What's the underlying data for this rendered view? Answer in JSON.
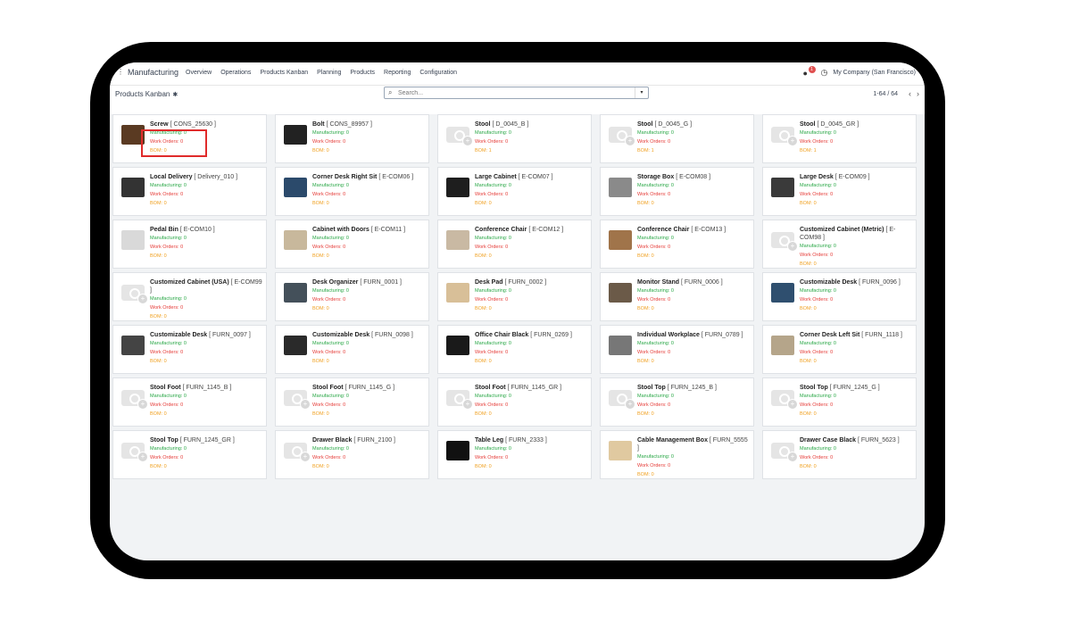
{
  "nav": {
    "app": "Manufacturing",
    "menu": [
      "Overview",
      "Operations",
      "Products Kanban",
      "Planning",
      "Products",
      "Reporting",
      "Configuration"
    ],
    "chat_badge": "1",
    "company": "My Company (San Francisco)"
  },
  "control": {
    "title": "Products Kanban",
    "search_placeholder": "Search...",
    "pager": "1-64 / 64"
  },
  "labels": {
    "manufacturing": "Manufacturing: 0",
    "work_orders": "Work Orders: 0"
  },
  "cards": [
    {
      "name": "Screw",
      "code": "[ CONS_25630 ]",
      "bom": "BOM: 0",
      "img": "photo",
      "color": "#5a3a22"
    },
    {
      "name": "Bolt",
      "code": "[ CONS_89957 ]",
      "bom": "BOM: 0",
      "img": "photo",
      "color": "#222222"
    },
    {
      "name": "Stool",
      "code": "[ D_0045_B ]",
      "bom": "BOM: 1",
      "img": "placeholder"
    },
    {
      "name": "Stool",
      "code": "[ D_0045_G ]",
      "bom": "BOM: 1",
      "img": "placeholder"
    },
    {
      "name": "Stool",
      "code": "[ D_0045_GR ]",
      "bom": "BOM: 1",
      "img": "placeholder"
    },
    {
      "name": "Local Delivery",
      "code": "[ Delivery_010 ]",
      "bom": "BOM: 0",
      "img": "photo",
      "color": "#333333"
    },
    {
      "name": "Corner Desk Right Sit",
      "code": "[ E-COM06 ]",
      "bom": "BOM: 0",
      "img": "photo",
      "color": "#2b4a6b"
    },
    {
      "name": "Large Cabinet",
      "code": "[ E-COM07 ]",
      "bom": "BOM: 0",
      "img": "photo",
      "color": "#1e1e1e"
    },
    {
      "name": "Storage Box",
      "code": "[ E-COM08 ]",
      "bom": "BOM: 0",
      "img": "photo",
      "color": "#8a8a8a"
    },
    {
      "name": "Large Desk",
      "code": "[ E-COM09 ]",
      "bom": "BOM: 0",
      "img": "photo",
      "color": "#3a3a3a"
    },
    {
      "name": "Pedal Bin",
      "code": "[ E-COM10 ]",
      "bom": "BOM: 0",
      "img": "photo",
      "color": "#d9d9d9"
    },
    {
      "name": "Cabinet with Doors",
      "code": "[ E-COM11 ]",
      "bom": "BOM: 0",
      "img": "photo",
      "color": "#c8b89c"
    },
    {
      "name": "Conference Chair",
      "code": "[ E-COM12 ]",
      "bom": "BOM: 0",
      "img": "photo",
      "color": "#c9b9a3"
    },
    {
      "name": "Conference Chair",
      "code": "[ E-COM13 ]",
      "bom": "BOM: 0",
      "img": "photo",
      "color": "#a0744a"
    },
    {
      "name": "Customized Cabinet (Metric)",
      "code": "[ E-COM98 ]",
      "bom": "BOM: 0",
      "img": "placeholder"
    },
    {
      "name": "Customized Cabinet (USA)",
      "code": "[ E-COM99 ]",
      "bom": "BOM: 0",
      "img": "placeholder"
    },
    {
      "name": "Desk Organizer",
      "code": "[ FURN_0001 ]",
      "bom": "BOM: 0",
      "img": "photo",
      "color": "#44505a"
    },
    {
      "name": "Desk Pad",
      "code": "[ FURN_0002 ]",
      "bom": "BOM: 0",
      "img": "photo",
      "color": "#d8bf98"
    },
    {
      "name": "Monitor Stand",
      "code": "[ FURN_0006 ]",
      "bom": "BOM: 0",
      "img": "photo",
      "color": "#6b5a48"
    },
    {
      "name": "Customizable Desk",
      "code": "[ FURN_0096 ]",
      "bom": "BOM: 0",
      "img": "photo",
      "color": "#2f4f6f"
    },
    {
      "name": "Customizable Desk",
      "code": "[ FURN_0097 ]",
      "bom": "BOM: 0",
      "img": "photo",
      "color": "#444444"
    },
    {
      "name": "Customizable Desk",
      "code": "[ FURN_0098 ]",
      "bom": "BOM: 0",
      "img": "photo",
      "color": "#2a2a2a"
    },
    {
      "name": "Office Chair Black",
      "code": "[ FURN_0269 ]",
      "bom": "BOM: 0",
      "img": "photo",
      "color": "#1a1a1a"
    },
    {
      "name": "Individual Workplace",
      "code": "[ FURN_0789 ]",
      "bom": "BOM: 0",
      "img": "photo",
      "color": "#777777"
    },
    {
      "name": "Corner Desk Left Sit",
      "code": "[ FURN_1118 ]",
      "bom": "BOM: 0",
      "img": "photo",
      "color": "#b5a58a"
    },
    {
      "name": "Stool Foot",
      "code": "[ FURN_1145_B ]",
      "bom": "BOM: 0",
      "img": "placeholder"
    },
    {
      "name": "Stool Foot",
      "code": "[ FURN_1145_G ]",
      "bom": "BOM: 0",
      "img": "placeholder"
    },
    {
      "name": "Stool Foot",
      "code": "[ FURN_1145_GR ]",
      "bom": "BOM: 0",
      "img": "placeholder"
    },
    {
      "name": "Stool Top",
      "code": "[ FURN_1245_B ]",
      "bom": "BOM: 0",
      "img": "placeholder"
    },
    {
      "name": "Stool Top",
      "code": "[ FURN_1245_G ]",
      "bom": "BOM: 0",
      "img": "placeholder"
    },
    {
      "name": "Stool Top",
      "code": "[ FURN_1245_GR ]",
      "bom": "BOM: 0",
      "img": "placeholder"
    },
    {
      "name": "Drawer Black",
      "code": "[ FURN_2100 ]",
      "bom": "BOM: 0",
      "img": "placeholder"
    },
    {
      "name": "Table Leg",
      "code": "[ FURN_2333 ]",
      "bom": "BOM: 0",
      "img": "photo",
      "color": "#111111"
    },
    {
      "name": "Cable Management Box",
      "code": "[ FURN_5555 ]",
      "bom": "BOM: 0",
      "img": "photo",
      "color": "#e0c9a0"
    },
    {
      "name": "Drawer Case Black",
      "code": "[ FURN_5623 ]",
      "bom": "BOM: 0",
      "img": "placeholder"
    }
  ]
}
